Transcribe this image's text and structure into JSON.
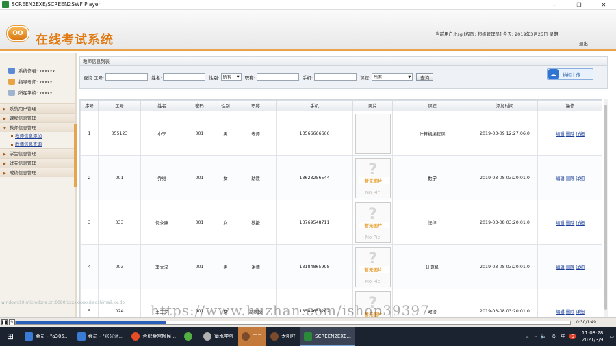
{
  "window": {
    "title": "SCREEN2EXE/SCREEN2SWF Player",
    "minimize": "–",
    "maximize": "❐",
    "close": "✕"
  },
  "header": {
    "logo_text": "OO",
    "system_name": "在线考试系统",
    "user_info": "当前用户:hsg [权限: 超级管理员] 今天: 2019年3月25日  星期一",
    "logout": "退出"
  },
  "sidebar": {
    "info": [
      {
        "icon": "user-icon",
        "text": "系统作者: xxxxxx"
      },
      {
        "icon": "teacher-icon",
        "text": "指导老师: xxxxx"
      },
      {
        "icon": "school-icon",
        "text": "所在学校: xxxxx"
      }
    ],
    "menu": [
      {
        "label": "系统用户管理",
        "subs": []
      },
      {
        "label": "课程信息管理",
        "subs": []
      },
      {
        "label": "教师信息管理",
        "subs": [
          "教师信息添加",
          "教师信息查询"
        ]
      },
      {
        "label": "学生信息管理",
        "subs": []
      },
      {
        "label": "试卷信息管理",
        "subs": []
      },
      {
        "label": "成绩信息管理",
        "subs": []
      }
    ]
  },
  "panel": {
    "title": "教师信息列表"
  },
  "search": {
    "query_label": "查询",
    "id_label": "工号:",
    "name_label": "姓名:",
    "gender_label": "性别:",
    "gender_value": "所有",
    "title_label": "职称:",
    "phone_label": "手机:",
    "course_label": "课程:",
    "course_value": "所有",
    "button": "查询",
    "upload": "拍拖上传"
  },
  "table": {
    "headers": [
      "序号",
      "工号",
      "姓名",
      "密码",
      "性别",
      "职称",
      "手机",
      "照片",
      "课程",
      "添加时间",
      "操作"
    ],
    "photo_placeholder": {
      "title": "暂无图片",
      "sub": "No Pic"
    },
    "actions": [
      "编辑",
      "删除",
      "详细"
    ],
    "rows": [
      {
        "no": "1",
        "id": "055123",
        "name": "小李",
        "pwd": "001",
        "gender": "男",
        "title": "老师",
        "phone": "13566666666",
        "photo": "blank",
        "course": "计算机编程课",
        "time": "2019-03-09 12:27:06.0"
      },
      {
        "no": "2",
        "id": "001",
        "name": "乔维",
        "pwd": "001",
        "gender": "女",
        "title": "助教",
        "phone": "13623256544",
        "photo": "none",
        "course": "数学",
        "time": "2019-03-08 03:20:01.0"
      },
      {
        "no": "3",
        "id": "033",
        "name": "何永康",
        "pwd": "001",
        "gender": "女",
        "title": "教授",
        "phone": "13769548711",
        "photo": "none",
        "course": "法律",
        "time": "2019-03-08 03:20:01.0"
      },
      {
        "no": "4",
        "id": "003",
        "name": "李大汉",
        "pwd": "001",
        "gender": "男",
        "title": "讲师",
        "phone": "13184865998",
        "photo": "none",
        "course": "计算机",
        "time": "2019-03-08 03:20:01.0"
      },
      {
        "no": "5",
        "id": "024",
        "name": "王兰梦",
        "pwd": "001",
        "gender": "女",
        "title": "副教授",
        "phone": "13544655202",
        "photo": "none",
        "course": "政治",
        "time": "2019-03-08 03:20:01.0"
      }
    ]
  },
  "overlay": {
    "url": "windows10.microdone.cn:8080/xxxxxxxxx/jiaoshimail.xx.do",
    "watermark": "https://www.huzhan.com/ishop39397"
  },
  "player": {
    "time": "0:30/1:49",
    "progress": 0.27
  },
  "taskbar": {
    "items": [
      {
        "label": "会员 - \"a305...",
        "color": "#3a7bd5"
      },
      {
        "label": "会员 - \"张光蓝...",
        "color": "#3a7bd5"
      },
      {
        "label": "合肥金宫额民...",
        "color": "#e44d26"
      },
      {
        "label": "",
        "color": "#52b043"
      },
      {
        "label": "衡水学院",
        "color": "#b0b0b0"
      },
      {
        "label": "三三",
        "color": "#7a4a2a"
      },
      {
        "label": "太阳吖",
        "color": "#7a4a2a"
      },
      {
        "label": "SCREEN2EXE...",
        "color": "#2a8a3a"
      }
    ],
    "tray": {
      "lang": "中",
      "s_icon": "S",
      "time": "11:08:28",
      "date": "2021/3/9"
    }
  }
}
